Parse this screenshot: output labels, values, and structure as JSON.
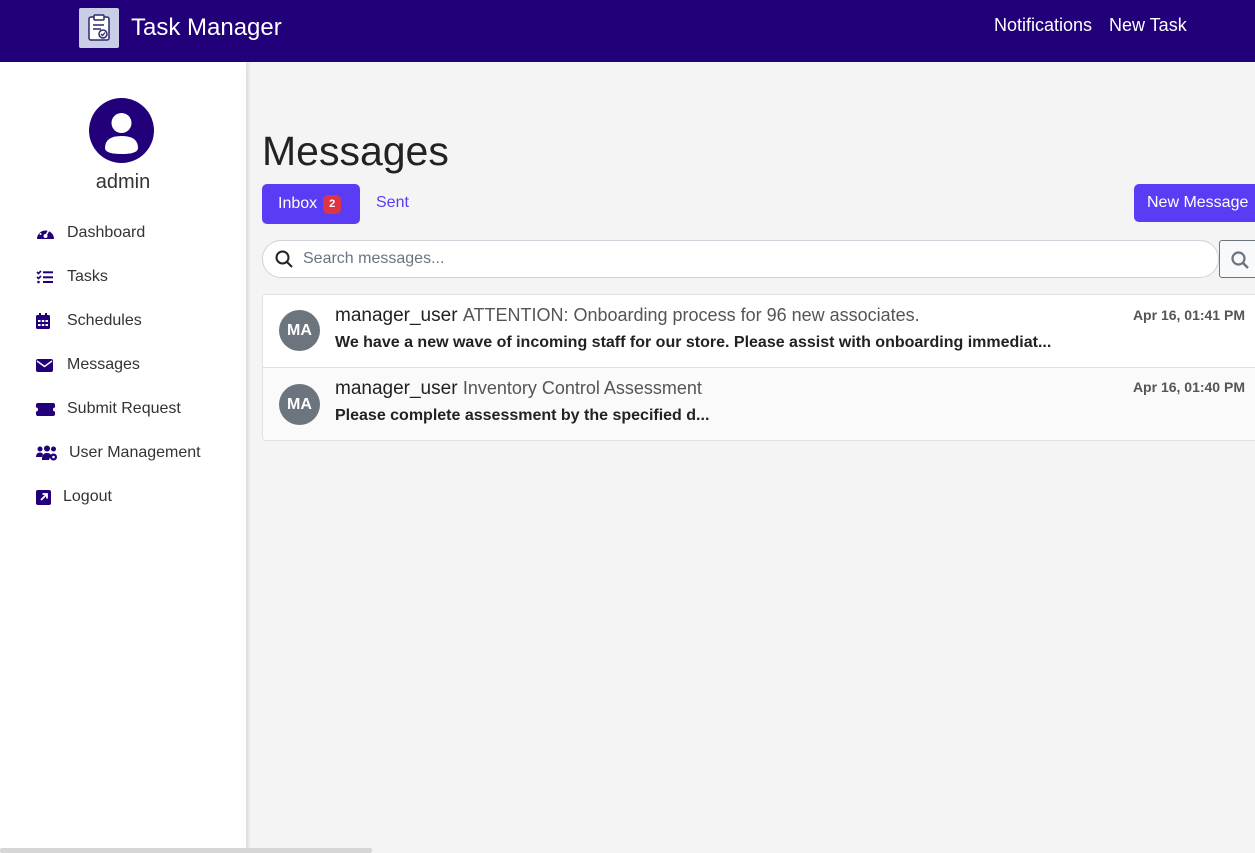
{
  "header": {
    "brand_title": "Task Manager",
    "logo_icon": "clipboard-check-icon",
    "nav": [
      {
        "label": "Notifications"
      },
      {
        "label": "New Task"
      }
    ],
    "background_color": "#22007a"
  },
  "sidebar": {
    "username": "admin",
    "avatar_icon": "user-avatar-icon",
    "items": [
      {
        "label": "Dashboard",
        "icon": "gauge-icon"
      },
      {
        "label": "Tasks",
        "icon": "list-check-icon"
      },
      {
        "label": "Schedules",
        "icon": "calendar-icon"
      },
      {
        "label": "Messages",
        "icon": "envelope-icon"
      },
      {
        "label": "Submit Request",
        "icon": "ticket-icon"
      },
      {
        "label": "User Management",
        "icon": "users-gear-icon"
      },
      {
        "label": "Logout",
        "icon": "external-link-icon"
      }
    ]
  },
  "main": {
    "title": "Messages",
    "tabs": {
      "inbox_label": "Inbox",
      "inbox_count": "2",
      "sent_label": "Sent"
    },
    "new_message_label": "New Message",
    "search": {
      "placeholder": "Search messages...",
      "value": ""
    },
    "messages": [
      {
        "avatar_initials": "MA",
        "sender": "manager_user",
        "subject": "ATTENTION: Onboarding process for 96 new associates.",
        "preview": "We have a new wave of incoming staff for our store. Please assist with onboarding immediat...",
        "date": "Apr 16, 01:41 PM"
      },
      {
        "avatar_initials": "MA",
        "sender": "manager_user",
        "subject": "Inventory Control Assessment",
        "preview": "Please complete assessment by the specified d...",
        "date": "Apr 16, 01:40 PM"
      }
    ]
  },
  "colors": {
    "accent": "#5a3cf5",
    "badge": "#dc3545",
    "avatar_gray": "#6c757d"
  }
}
